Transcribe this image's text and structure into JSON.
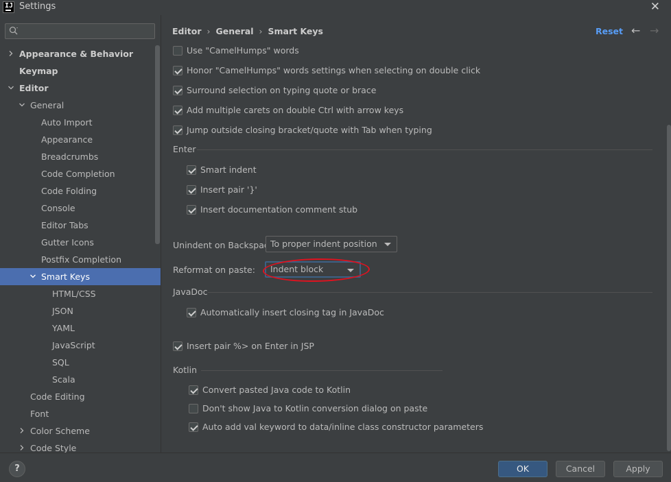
{
  "window": {
    "title": "Settings",
    "logo": "IJ"
  },
  "search": {
    "value": "",
    "placeholder": ""
  },
  "tree": [
    {
      "label": "Appearance & Behavior",
      "bold": true,
      "chevron": "right"
    },
    {
      "label": "Keymap",
      "bold": true,
      "chevron": ""
    },
    {
      "label": "Editor",
      "bold": true,
      "chevron": "down"
    },
    {
      "label": "General",
      "bold": false,
      "chevron": "down"
    },
    {
      "label": "Auto Import",
      "bold": false,
      "chevron": ""
    },
    {
      "label": "Appearance",
      "bold": false,
      "chevron": ""
    },
    {
      "label": "Breadcrumbs",
      "bold": false,
      "chevron": ""
    },
    {
      "label": "Code Completion",
      "bold": false,
      "chevron": ""
    },
    {
      "label": "Code Folding",
      "bold": false,
      "chevron": ""
    },
    {
      "label": "Console",
      "bold": false,
      "chevron": ""
    },
    {
      "label": "Editor Tabs",
      "bold": false,
      "chevron": ""
    },
    {
      "label": "Gutter Icons",
      "bold": false,
      "chevron": ""
    },
    {
      "label": "Postfix Completion",
      "bold": false,
      "chevron": ""
    },
    {
      "label": "Smart Keys",
      "bold": false,
      "chevron": "down",
      "selected": true
    },
    {
      "label": "HTML/CSS",
      "bold": false,
      "chevron": ""
    },
    {
      "label": "JSON",
      "bold": false,
      "chevron": ""
    },
    {
      "label": "YAML",
      "bold": false,
      "chevron": ""
    },
    {
      "label": "JavaScript",
      "bold": false,
      "chevron": ""
    },
    {
      "label": "SQL",
      "bold": false,
      "chevron": ""
    },
    {
      "label": "Scala",
      "bold": false,
      "chevron": ""
    },
    {
      "label": "Code Editing",
      "bold": false,
      "chevron": ""
    },
    {
      "label": "Font",
      "bold": false,
      "chevron": ""
    },
    {
      "label": "Color Scheme",
      "bold": false,
      "chevron": "right"
    },
    {
      "label": "Code Style",
      "bold": false,
      "chevron": "right"
    }
  ],
  "breadcrumb": [
    "Editor",
    "General",
    "Smart Keys"
  ],
  "header": {
    "reset": "Reset",
    "back_icon": "arrow-left-icon",
    "forward_icon": "arrow-right-icon"
  },
  "options": {
    "camelhumps": {
      "label": "Use \"CamelHumps\" words",
      "checked": false
    },
    "honor_camelhumps": {
      "label": "Honor \"CamelHumps\" words settings when selecting on double click",
      "checked": true
    },
    "surround": {
      "label": "Surround selection on typing quote or brace",
      "checked": true
    },
    "multi_carets": {
      "label": "Add multiple carets on double Ctrl with arrow keys",
      "checked": true
    },
    "jump_outside": {
      "label": "Jump outside closing bracket/quote with Tab when typing",
      "checked": true
    },
    "smart_indent": {
      "label": "Smart indent",
      "checked": true
    },
    "insert_pair_brace": {
      "label": "Insert pair '}'",
      "checked": true
    },
    "doc_stub": {
      "label": "Insert documentation comment stub",
      "checked": true
    },
    "javadoc_closing_tag": {
      "label": "Automatically insert closing tag in JavaDoc",
      "checked": true
    },
    "jsp_pair": {
      "label": "Insert pair %> on Enter in JSP",
      "checked": true
    },
    "convert_kotlin": {
      "label": "Convert pasted Java code to Kotlin",
      "checked": true
    },
    "dont_show_kotlin": {
      "label": "Don't show Java to Kotlin conversion dialog on paste",
      "checked": false
    },
    "auto_val": {
      "label": "Auto add val keyword to data/inline class constructor parameters",
      "checked": true
    }
  },
  "groups": {
    "enter": "Enter",
    "javadoc": "JavaDoc",
    "kotlin": "Kotlin"
  },
  "unindent": {
    "label": "Unindent on Backspace:",
    "value": "To proper indent position"
  },
  "reformat": {
    "label": "Reformat on paste:",
    "value": "Indent block"
  },
  "annotation_color": "#e0121f",
  "buttons": {
    "help": "?",
    "ok": "OK",
    "cancel": "Cancel",
    "apply": "Apply"
  },
  "colors": {
    "selected_bg": "#4b6eaf",
    "link": "#589df6",
    "default_button": "#365880"
  }
}
